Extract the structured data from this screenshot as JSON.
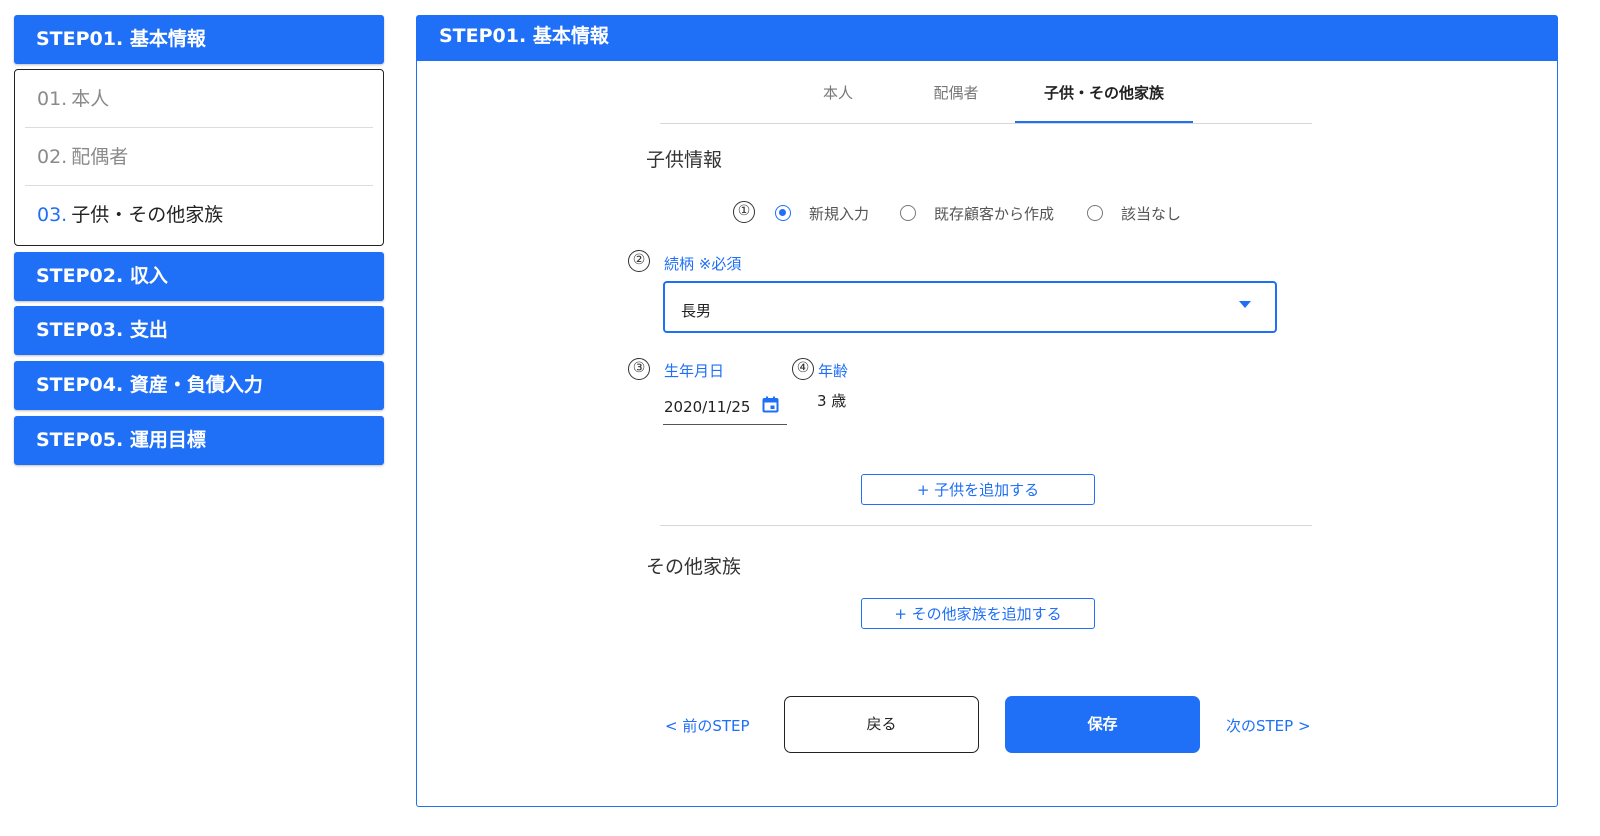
{
  "sidebar": {
    "step01": "STEP01. 基本情報",
    "sub_items": [
      {
        "num": "01.",
        "label": "本人"
      },
      {
        "num": "02.",
        "label": "配偶者"
      },
      {
        "num": "03.",
        "label": "子供・その他家族"
      }
    ],
    "step02": "STEP02. 収入",
    "step03": "STEP03. 支出",
    "step04": "STEP04. 資産・負債入力",
    "step05": "STEP05. 運用目標"
  },
  "panel": {
    "title": "STEP01. 基本情報",
    "tabs": [
      "本人",
      "配偶者",
      "子供・その他家族"
    ],
    "active_tab": "子供・その他家族"
  },
  "children_section": {
    "title": "子供情報",
    "marker1": "①",
    "input_options": [
      "新規入力",
      "既存顧客から作成",
      "該当なし"
    ],
    "selected_option": "新規入力",
    "marker2": "②",
    "relationship_label": "続柄 ※必須",
    "relationship_value": "長男",
    "marker3": "③",
    "birthdate_label": "生年月日",
    "birthdate_value": "2020/11/25",
    "marker4": "④",
    "age_label": "年齢",
    "age_value": "3 歳",
    "add_child_label": "+ 子供を追加する"
  },
  "other_family_section": {
    "title": "その他家族",
    "add_family_label": "+ その他家族を追加する"
  },
  "footer": {
    "prev_label": "< 前のSTEP",
    "back_label": "戻る",
    "save_label": "保存",
    "next_label": "次のSTEP >"
  },
  "colors": {
    "accent": "#1f6ff7",
    "text": "#333333",
    "muted": "#8a8a8a"
  }
}
